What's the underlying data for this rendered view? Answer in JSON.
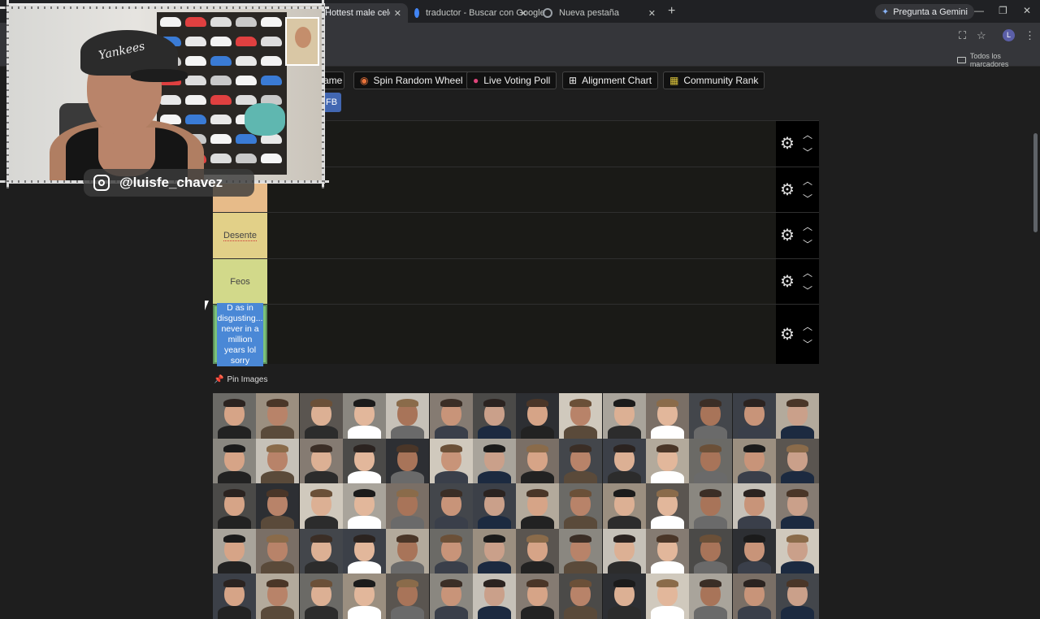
{
  "browser": {
    "tabs": [
      {
        "title": "Hottest male celebriti",
        "favicon_color": "#e8a33a"
      },
      {
        "title": "traductor - Buscar con Google",
        "favicon_color": "#4285f4"
      },
      {
        "title": "Nueva pestaña",
        "favicon_color": "#9aa0a6"
      }
    ],
    "gemini_label": "Pregunta a Gemini",
    "bookmarks_label": "Todos los marcadores",
    "avatar_letter": "L"
  },
  "toolbar": {
    "game_label": "ame",
    "spin_label": "Spin Random Wheel",
    "poll_label": "Live Voting Poll",
    "alignment_label": "Alignment Chart",
    "community_label": "Community Rank",
    "fb_label": "FB"
  },
  "tiers": [
    {
      "label": "",
      "color": "#f1a08a"
    },
    {
      "label": "",
      "color": "#e7bb89"
    },
    {
      "label": "Desente",
      "color": "#e2d088"
    },
    {
      "label": "Feos",
      "color": "#d2d98a"
    },
    {
      "label": "D as in disgusting... never in a million years lol sorry",
      "color": "#7cc279"
    }
  ],
  "pin_images_label": "Pin Images",
  "webcam": {
    "instagram_handle": "@luisfe_chavez",
    "cap_text": "Yankees"
  },
  "colors": {
    "page_bg": "#1e1e1e",
    "tier_row_bg": "#1a1a17",
    "control_bg": "#000000",
    "fb_blue": "#4267b2"
  }
}
